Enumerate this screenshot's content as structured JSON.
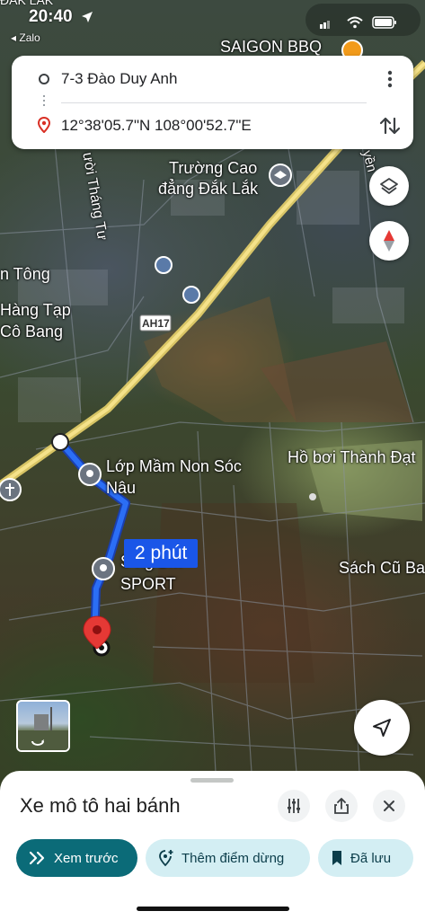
{
  "status_bar": {
    "time": "20:40",
    "back_app": "◂ Zalo",
    "region_partial": "ĐẮK LẮK"
  },
  "route": {
    "origin": "7-3 Đào Duy Anh",
    "destination": "12°38'05.7\"N 108°00'52.7\"E"
  },
  "map_labels": {
    "saigon_bbq": "SAIGON BBQ",
    "street_thang_tu": "ười Tháng Tư",
    "college_line1": "Trường Cao",
    "college_line2": "đẳng Đắk Lắk",
    "n_tong": "n Tông",
    "shop_line1": "Hàng Tạp",
    "shop_line2": "Cô Bang",
    "highway": "AH17",
    "kindergarten_line1": "Lớp Mầm Non Sóc",
    "kindergarten_line2": "Nâu",
    "pool": "Hồ bơi Thành Đạt",
    "sport_line1": "S           ng BM",
    "sport_line2": "SPORT",
    "bookshop": "Sách Cũ Ba",
    "yen": "yền"
  },
  "duration_label": "2 phút",
  "sheet": {
    "title": "Xe mô tô hai bánh",
    "chips": {
      "preview": "Xem trước",
      "add_stop": "Thêm điểm dừng",
      "saved": "Đã lưu"
    }
  },
  "colors": {
    "route_blue": "#1a56e8",
    "preview_chip_bg": "#0b6b78",
    "light_chip_bg": "#d3eef3",
    "pin_red": "#e53935"
  }
}
